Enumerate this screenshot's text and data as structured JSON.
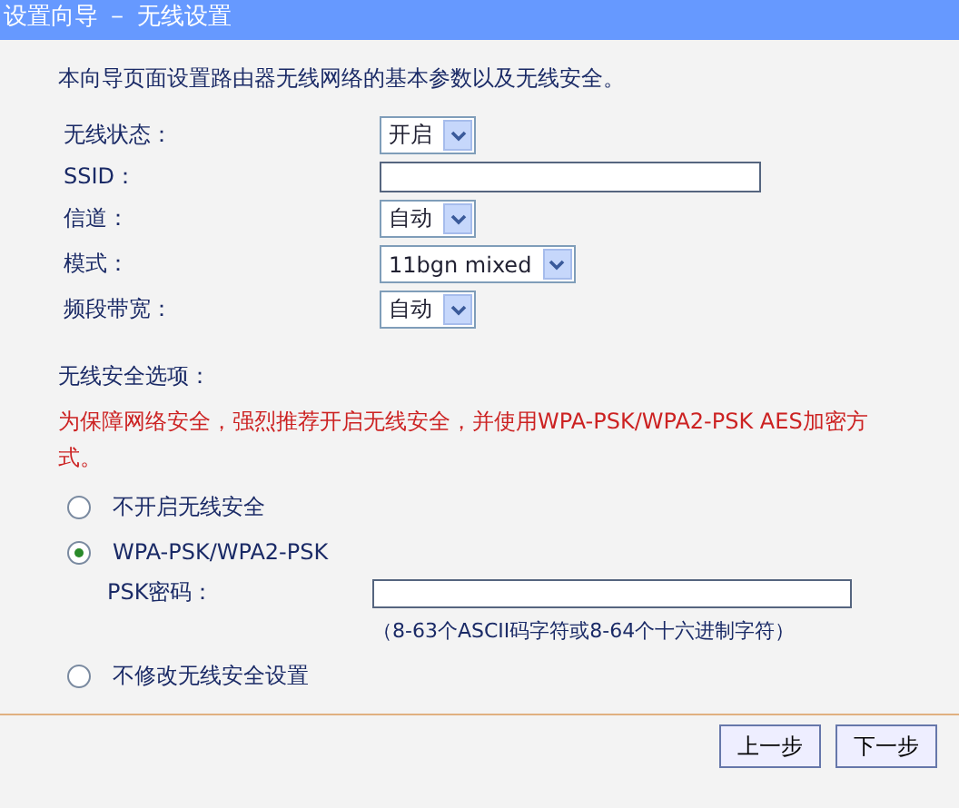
{
  "window": {
    "title": "设置向导 － 无线设置"
  },
  "intro": "本向导页面设置路由器无线网络的基本参数以及无线安全。",
  "fields": [
    {
      "label": "无线状态：",
      "kind": "select",
      "value": "开启"
    },
    {
      "label": "SSID：",
      "kind": "text"
    },
    {
      "label": "信道：",
      "kind": "select",
      "value": "自动"
    },
    {
      "label": "模式：",
      "kind": "select",
      "value": "11bgn mixed"
    },
    {
      "label": "频段带宽：",
      "kind": "select",
      "value": "自动"
    }
  ],
  "security": {
    "title": "无线安全选项：",
    "warning": "为保障网络安全，强烈推荐开启无线安全，并使用WPA-PSK/WPA2-PSK AES加密方式。",
    "options": [
      {
        "label": "不开启无线安全",
        "selected": false
      },
      {
        "label": "WPA-PSK/WPA2-PSK",
        "selected": true,
        "password_label": "PSK密码：",
        "hint": "（8-63个ASCII码字符或8-64个十六进制字符）"
      },
      {
        "label": "不修改无线安全设置",
        "selected": false
      }
    ]
  },
  "buttons": [
    "上一步",
    "下一步"
  ]
}
